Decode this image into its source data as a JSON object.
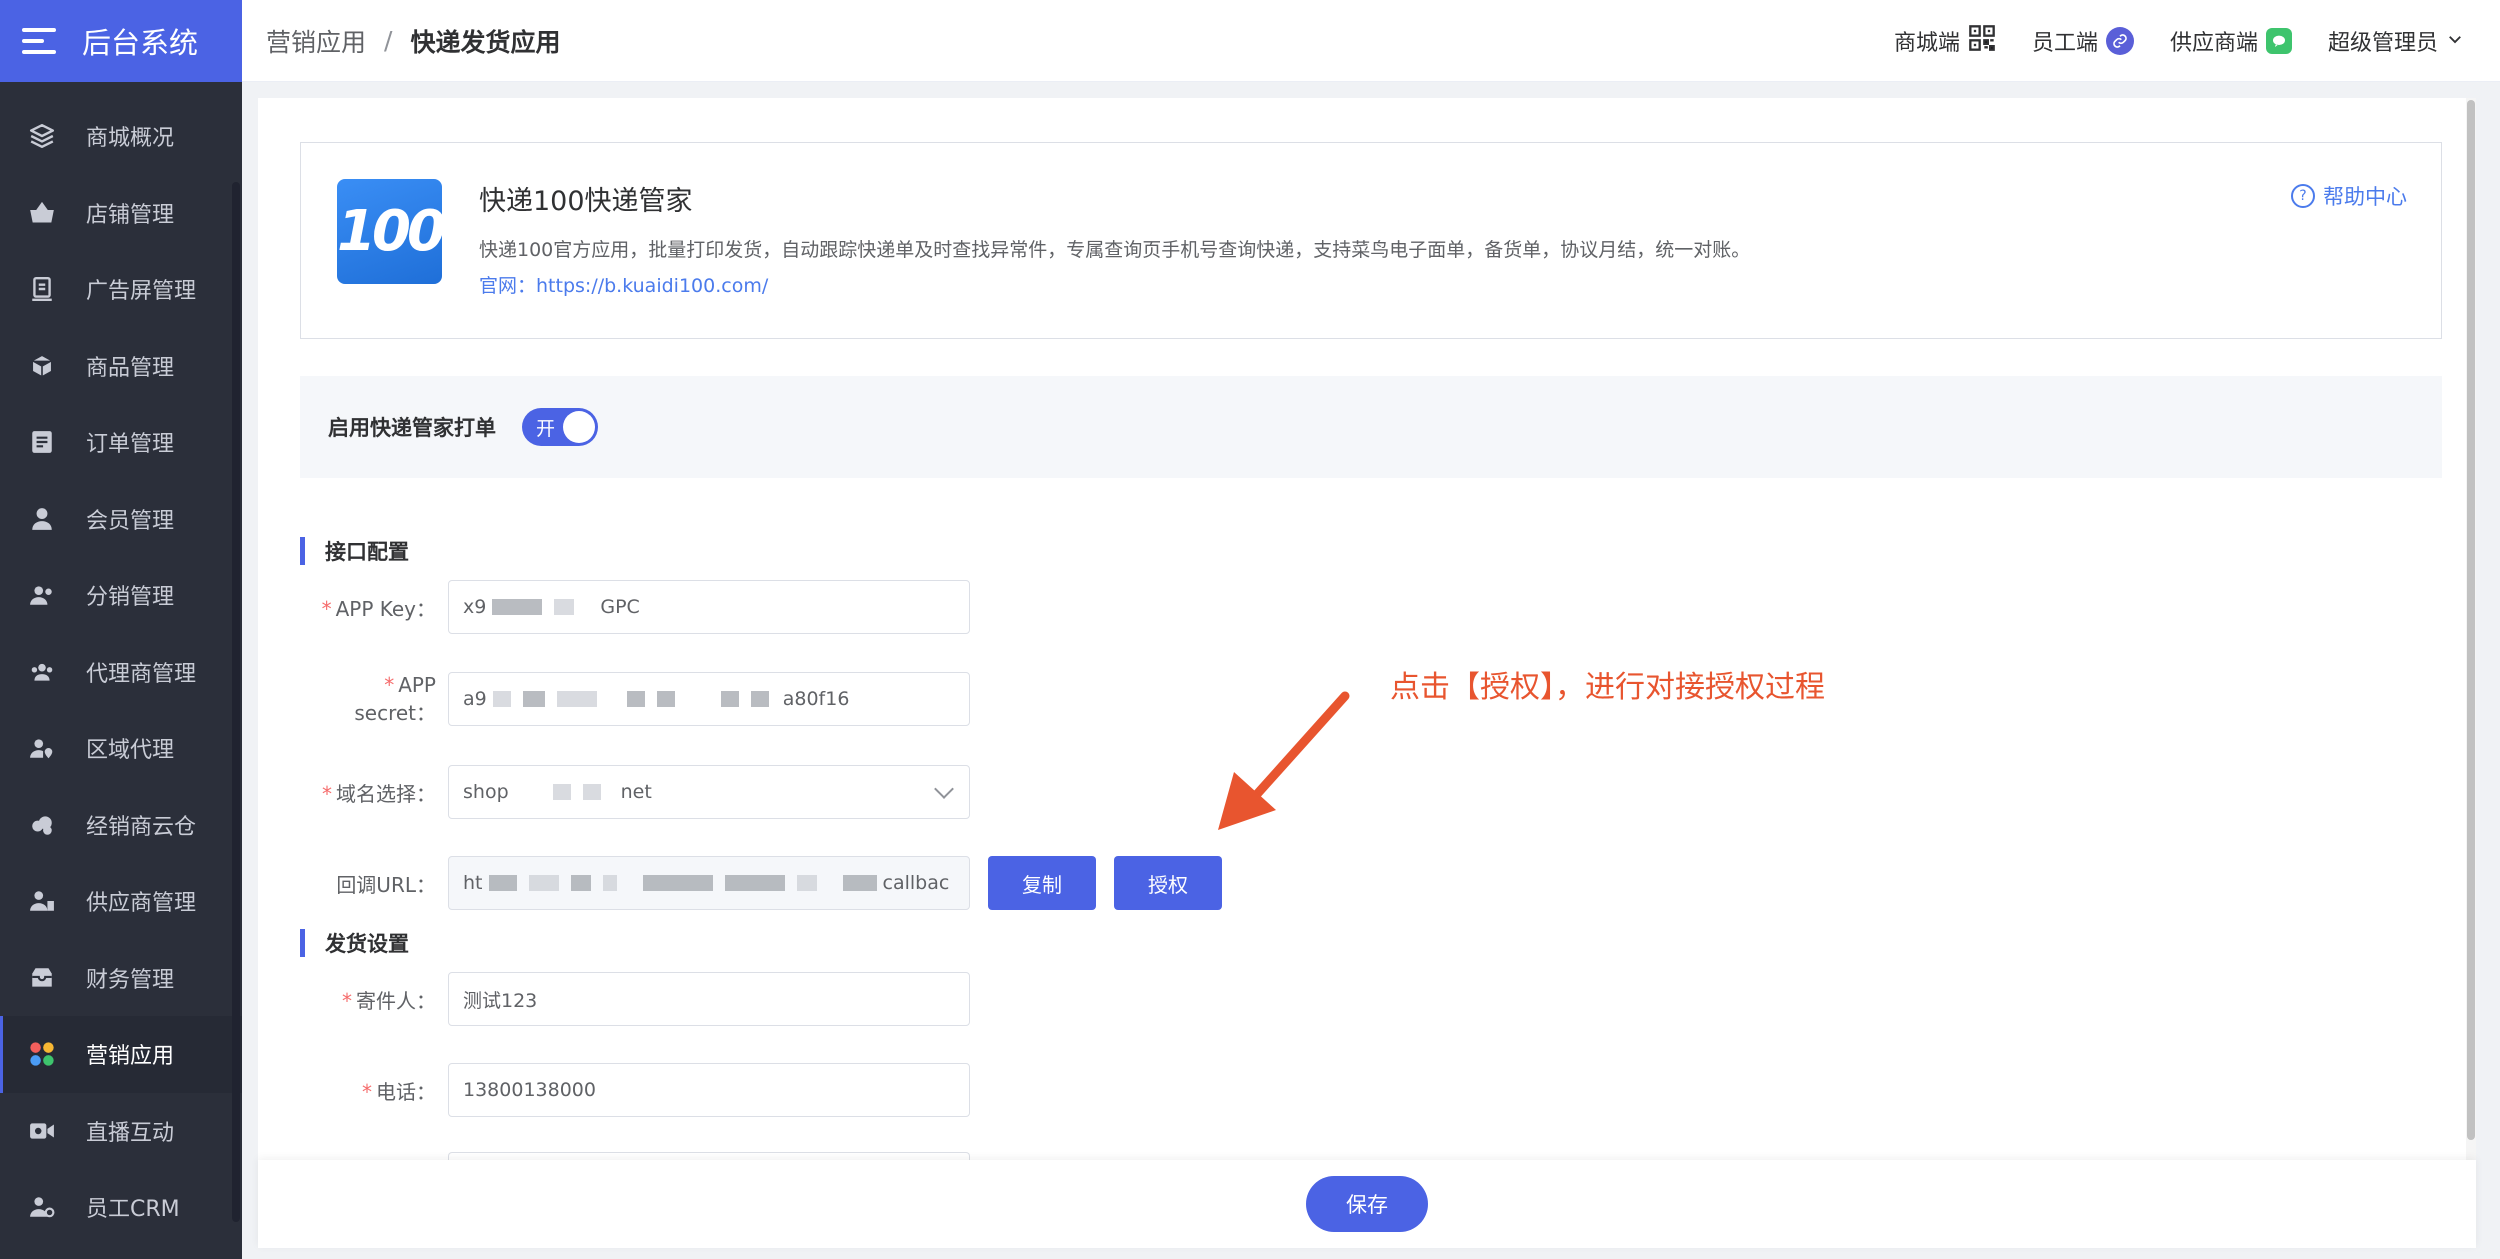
{
  "brand": {
    "title": "后台系统"
  },
  "sidebar": {
    "items": [
      {
        "label": "商城概况",
        "icon": "layers-icon"
      },
      {
        "label": "店铺管理",
        "icon": "basket-icon"
      },
      {
        "label": "广告屏管理",
        "icon": "screen-icon"
      },
      {
        "label": "商品管理",
        "icon": "box-icon"
      },
      {
        "label": "订单管理",
        "icon": "order-icon"
      },
      {
        "label": "会员管理",
        "icon": "user-icon"
      },
      {
        "label": "分销管理",
        "icon": "users-share-icon"
      },
      {
        "label": "代理商管理",
        "icon": "group-icon"
      },
      {
        "label": "区域代理",
        "icon": "location-user-icon"
      },
      {
        "label": "经销商云仓",
        "icon": "cloud-icon"
      },
      {
        "label": "供应商管理",
        "icon": "supplier-icon"
      },
      {
        "label": "财务管理",
        "icon": "wallet-icon"
      },
      {
        "label": "营销应用",
        "icon": "apps-icon",
        "active": true
      },
      {
        "label": "直播互动",
        "icon": "video-icon"
      },
      {
        "label": "员工CRM",
        "icon": "crm-icon"
      }
    ]
  },
  "header": {
    "breadcrumb": [
      "营销应用",
      "快递发货应用"
    ],
    "separator": "/",
    "links": [
      {
        "label": "商城端",
        "icon": "qrcode-icon"
      },
      {
        "label": "员工端",
        "icon": "link-icon"
      },
      {
        "label": "供应商端",
        "icon": "wechat-icon"
      }
    ],
    "user": "超级管理员"
  },
  "app": {
    "logo_text": "100",
    "title": "快递100快递管家",
    "description": "快递100官方应用，批量打印发货，自动跟踪快递单及时查找异常件，专属查询页手机号查询快递，支持菜鸟电子面单，备货单，协议月结，统一对账。",
    "site_label": "官网：",
    "site_url": "https://b.kuaidi100.com/",
    "help": "帮助中心"
  },
  "switch": {
    "label": "启用快递管家打单",
    "state": "开"
  },
  "api_section": {
    "title": "接口配置",
    "app_key": {
      "label": "APP Key：",
      "value_start": "x9",
      "value_end": "GPC"
    },
    "app_secret": {
      "label": "APP secret：",
      "value_start": "a9",
      "value_end": "a80f16"
    },
    "domain": {
      "label": "域名选择：",
      "value_start": "shop",
      "value_end": "net"
    },
    "callback": {
      "label": "回调URL：",
      "value_start": "ht",
      "value_end": "callbac"
    },
    "copy_btn": "复制",
    "auth_btn": "授权"
  },
  "ship_section": {
    "title": "发货设置",
    "sender": {
      "label": "寄件人：",
      "value": "测试123"
    },
    "phone": {
      "label": "电话：",
      "value": "13800138000"
    }
  },
  "annotation": "点击【授权】，进行对接授权过程",
  "footer": {
    "save": "保存"
  },
  "colors": {
    "primary": "#4b63e4",
    "sidebar": "#2b2f3a",
    "annotation": "#e8552f",
    "required": "#f56c6c"
  }
}
